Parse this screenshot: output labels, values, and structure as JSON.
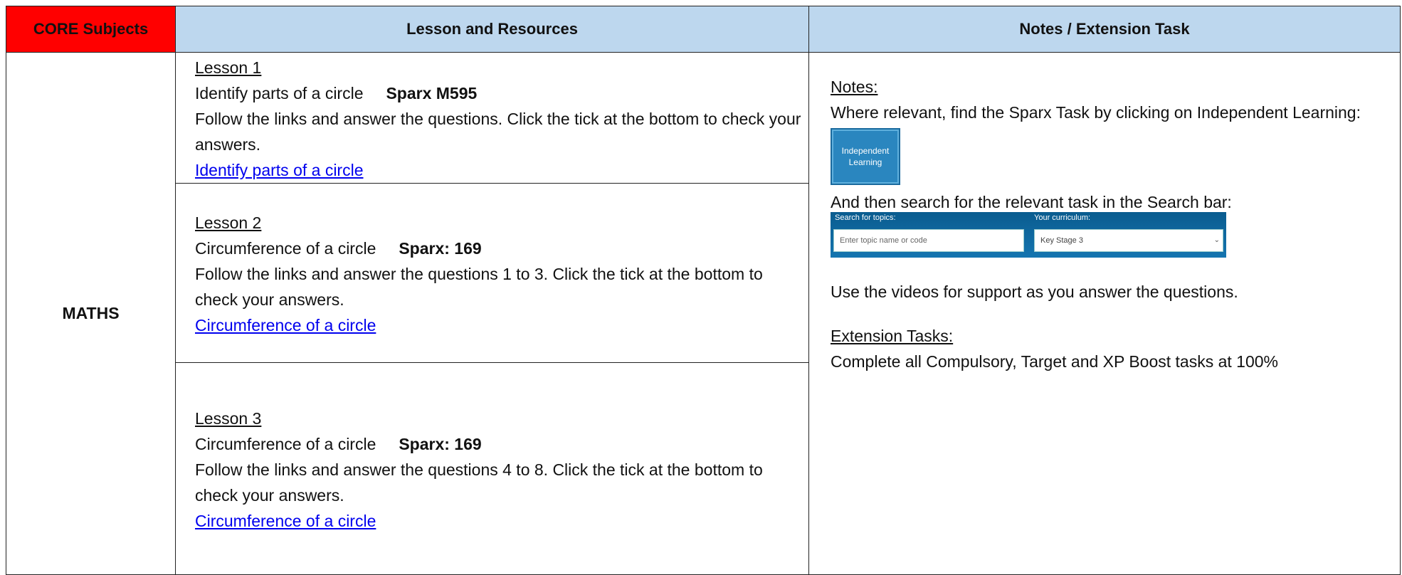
{
  "header": {
    "core": "CORE Subjects",
    "lesson": "Lesson and Resources",
    "notes": "Notes / Extension Task"
  },
  "subject": "MATHS",
  "lessons": [
    {
      "title": "Lesson 1",
      "topic": "Identify parts of a circle",
      "code": "Sparx M595",
      "instructions": "Follow the links and answer the questions. Click the tick at the bottom to check your answers.",
      "link": "Identify parts of a circle"
    },
    {
      "title": "Lesson 2",
      "topic": "Circumference of a circle",
      "code": "Sparx: 169",
      "instructions": "Follow the links and answer the questions 1 to 3. Click the tick at the bottom to check your answers.",
      "link": "Circumference of a circle"
    },
    {
      "title": "Lesson 3",
      "topic": "Circumference of a circle",
      "code": "Sparx: 169",
      "instructions": "Follow the links and answer the questions 4 to 8. Click the tick at the bottom to check your answers.",
      "link": "Circumference of a circle"
    }
  ],
  "notes": {
    "heading": "Notes:",
    "line1": "Where relevant, find the Sparx Task by clicking on Independent Learning:",
    "il_button_line1": "Independent",
    "il_button_line2": "Learning",
    "line2": "And then search for the relevant task in the Search bar:",
    "search": {
      "label_topics": "Search for topics:",
      "label_curriculum": "Your curriculum:",
      "placeholder": "Enter topic name or code",
      "curriculum_value": "Key Stage 3"
    },
    "line3": "Use the videos for support as you answer the questions.",
    "ext_heading": "Extension Tasks:",
    "ext_text": "Complete all Compulsory, Target and XP Boost tasks at 100%"
  },
  "colors": {
    "core_header_bg": "#ff0000",
    "header_bg": "#bdd7ee",
    "link": "#0000ee",
    "il_button_bg": "#2a86bf",
    "search_bar_bg": "#0a5c8f"
  }
}
